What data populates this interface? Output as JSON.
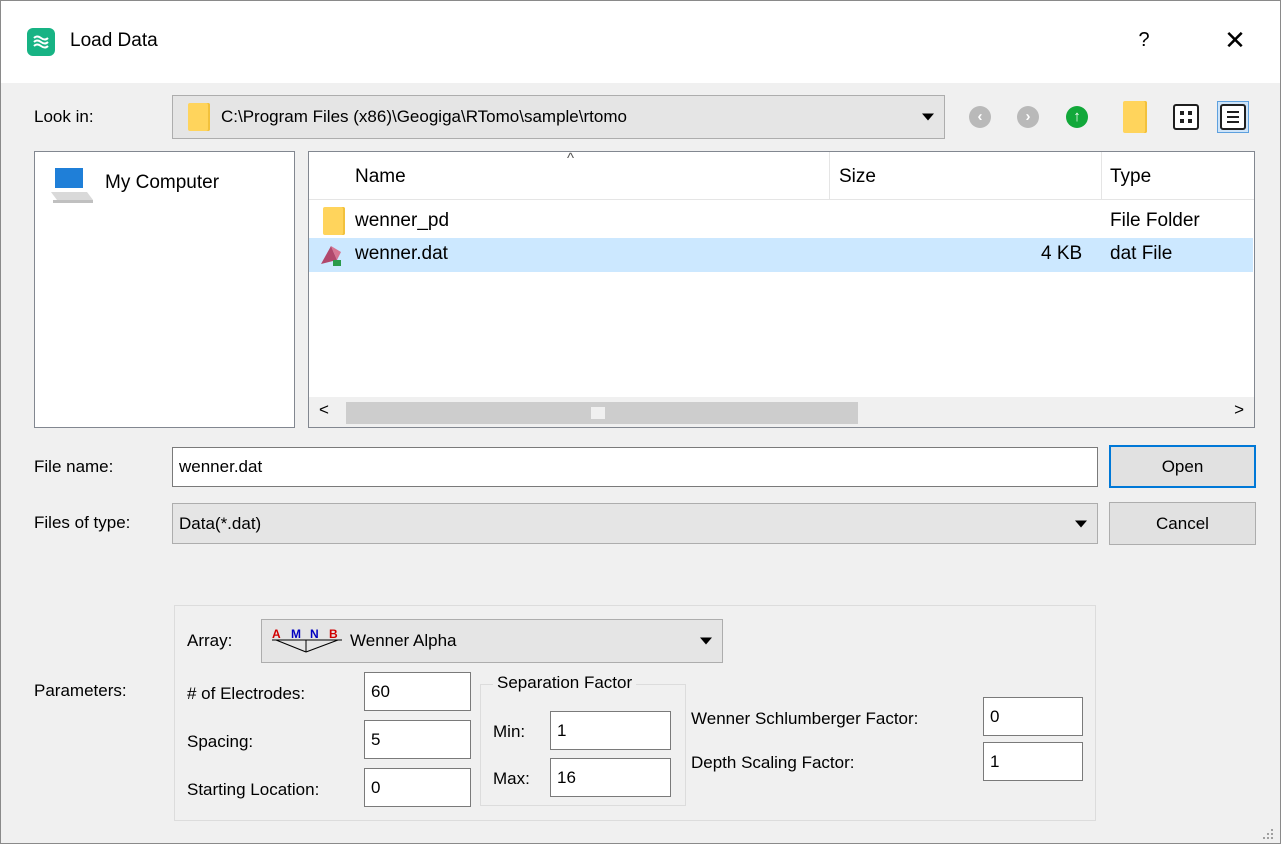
{
  "window": {
    "title": "Load Data",
    "help": "?",
    "close": "✕"
  },
  "lookin": {
    "label": "Look in:",
    "path": "C:\\Program Files (x86)\\Geogiga\\RTomo\\sample\\rtomo"
  },
  "places": {
    "items": [
      {
        "label": "My Computer",
        "icon": "computer-icon"
      }
    ]
  },
  "filelist": {
    "headers": {
      "name": "Name",
      "size": "Size",
      "type": "Type"
    },
    "rows": [
      {
        "name": "wenner_pd",
        "size": "",
        "type": "File Folder",
        "icon": "folder-icon",
        "selected": false
      },
      {
        "name": "wenner.dat",
        "size": "4 KB",
        "type": "dat File",
        "icon": "data-file-icon",
        "selected": true
      }
    ],
    "scroll_left": "<",
    "scroll_right": ">"
  },
  "filename": {
    "label": "File name:",
    "value": "wenner.dat",
    "open": "Open",
    "cancel": "Cancel"
  },
  "filetype": {
    "label": "Files of type:",
    "value": "Data(*.dat)"
  },
  "params": {
    "label": "Parameters:",
    "array_label": "Array:",
    "array_value": "Wenner Alpha",
    "array_icon_letters": "AMNB",
    "electrodes_label": "# of Electrodes:",
    "electrodes_value": "60",
    "spacing_label": "Spacing:",
    "spacing_value": "5",
    "start_label": "Starting Location:",
    "start_value": "0",
    "separation_title": "Separation Factor",
    "min_label": "Min:",
    "min_value": "1",
    "max_label": "Max:",
    "max_value": "16",
    "ws_label": "Wenner Schlumberger Factor:",
    "ws_value": "0",
    "depth_label": "Depth Scaling Factor:",
    "depth_value": "1"
  },
  "colors": {
    "accent": "#0078d7",
    "selection": "#cce8ff",
    "app_icon": "#17b384",
    "folder": "#ffd45c"
  }
}
